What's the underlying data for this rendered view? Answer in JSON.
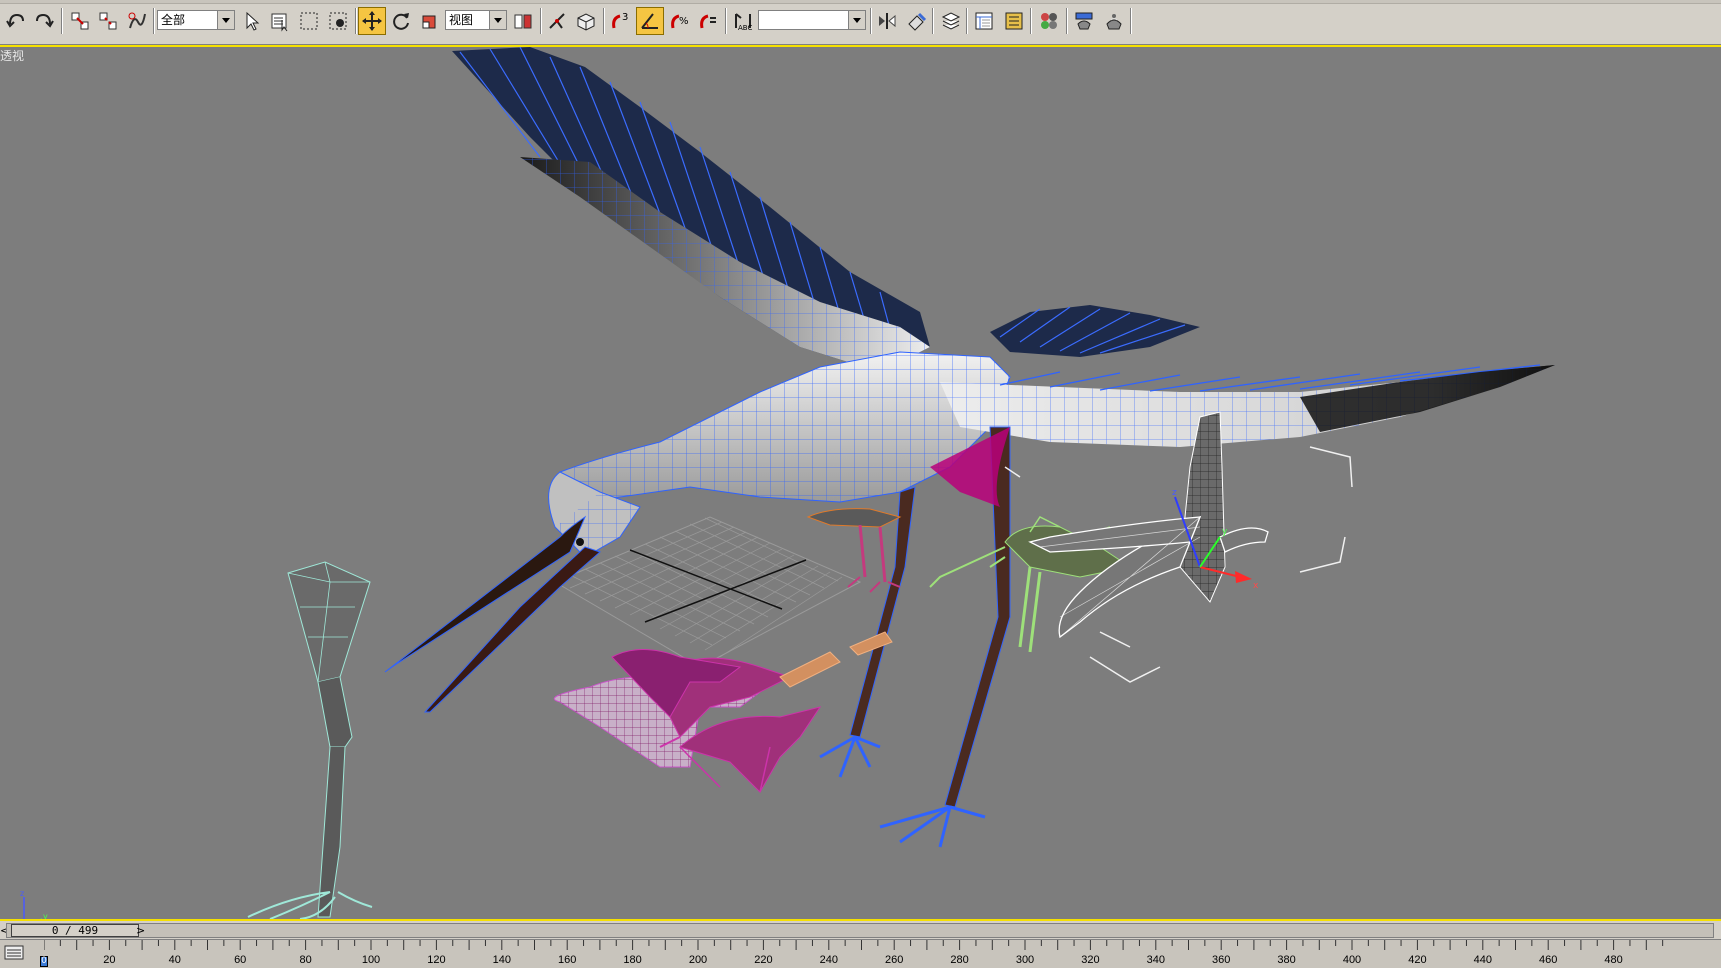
{
  "toolbar": {
    "selection_filter": "全部",
    "reference_coord": "视图",
    "named_selection": "",
    "snap_count": "3",
    "active_color": "#f5c542",
    "icons": [
      "undo-icon",
      "redo-icon",
      "select-link-icon",
      "unlink-icon",
      "bind-spacewarp-icon",
      "select-object-icon",
      "select-by-name-icon",
      "rect-selection-icon",
      "window-crossing-icon",
      "move-icon",
      "rotate-icon",
      "scale-icon",
      "pivot-icon",
      "manipulate-icon",
      "keyboard-shortcut-icon",
      "snap-toggle-icon",
      "angle-snap-icon",
      "percent-snap-icon",
      "spinner-snap-icon",
      "edit-named-selection-icon",
      "mirror-icon",
      "align-icon",
      "layer-manager-icon",
      "curve-editor-icon",
      "schematic-view-icon",
      "material-editor-icon",
      "render-setup-icon",
      "quick-render-icon"
    ]
  },
  "viewport": {
    "label": "透视",
    "background": "#7d7d7d",
    "border_color": "#f5e000"
  },
  "timeslider": {
    "value": "0 / 499",
    "prev": "<",
    "next": ">"
  },
  "trackbar": {
    "current_frame": "0",
    "ticks": [
      "20",
      "40",
      "60",
      "80",
      "100",
      "120",
      "140",
      "160",
      "180",
      "200",
      "220",
      "240",
      "260",
      "280",
      "300",
      "320",
      "340",
      "360",
      "380",
      "400",
      "420",
      "440",
      "460",
      "480"
    ]
  }
}
